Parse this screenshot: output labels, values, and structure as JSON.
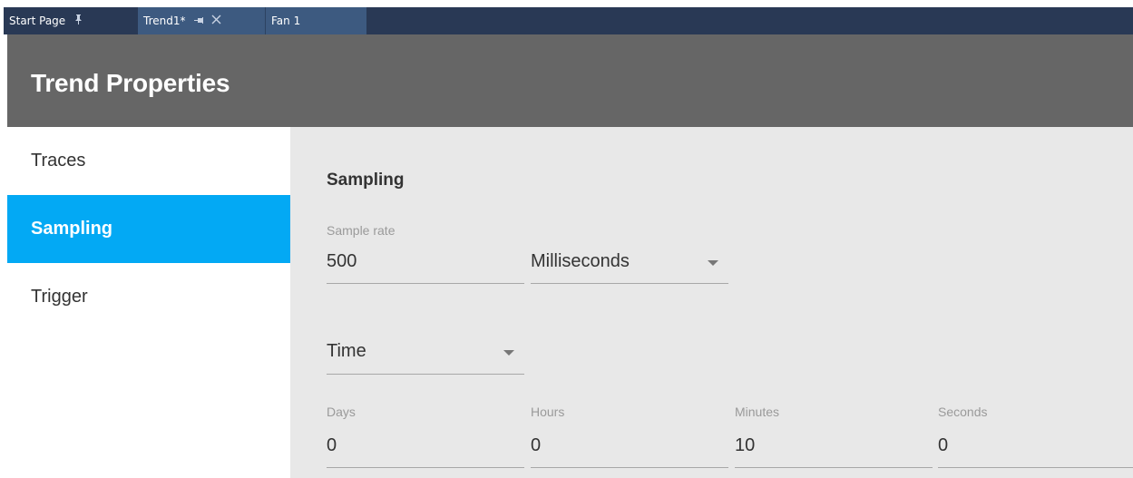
{
  "tabs": [
    {
      "label": "Start Page",
      "pin": "ᴘ",
      "active": false
    },
    {
      "label": "Trend1*",
      "pin": "⇥",
      "close": "✕",
      "active": true
    },
    {
      "label": "Fan 1",
      "active": false
    }
  ],
  "tab_icons": {
    "start_pin": "pin-icon",
    "trend_pin": "pin-icon",
    "trend_close": "close-icon"
  },
  "header": {
    "title": "Trend Properties"
  },
  "sidebar": {
    "items": [
      {
        "label": "Traces",
        "selected": false
      },
      {
        "label": "Sampling",
        "selected": true
      },
      {
        "label": "Trigger",
        "selected": false
      }
    ]
  },
  "sampling": {
    "section_title": "Sampling",
    "sample_rate": {
      "label": "Sample rate",
      "value": "500",
      "unit": "Milliseconds"
    },
    "mode": {
      "value": "Time"
    },
    "duration": {
      "days": {
        "label": "Days",
        "value": "0"
      },
      "hours": {
        "label": "Hours",
        "value": "0"
      },
      "minutes": {
        "label": "Minutes",
        "value": "10"
      },
      "seconds": {
        "label": "Seconds",
        "value": "0"
      }
    }
  },
  "colors": {
    "tabbar_bg": "#293955",
    "tab_active_bg": "#3d5a80",
    "header_bg": "#666666",
    "accent": "#03a9f4",
    "content_bg": "#e8e8e8"
  }
}
